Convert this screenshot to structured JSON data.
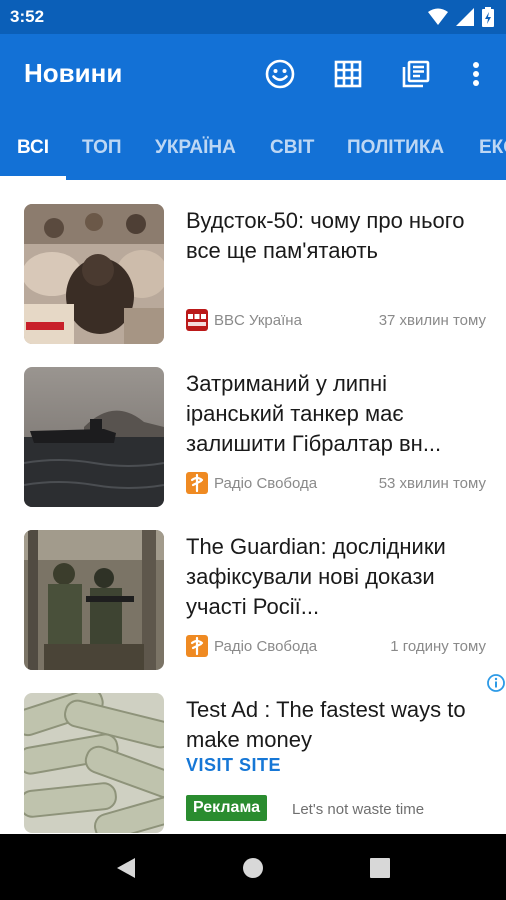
{
  "status": {
    "time": "3:52"
  },
  "app": {
    "title": "Новини"
  },
  "actions": [
    {
      "icon": "emoji-icon"
    },
    {
      "icon": "grid-icon"
    },
    {
      "icon": "library-icon"
    },
    {
      "icon": "more-vert-icon"
    }
  ],
  "tabs": [
    {
      "label": "ВСІ",
      "active": true
    },
    {
      "label": "ТОП"
    },
    {
      "label": "УКРАЇНА"
    },
    {
      "label": "СВІТ"
    },
    {
      "label": "ПОЛІТИКА"
    },
    {
      "label": "ЕКО"
    }
  ],
  "articles": [
    {
      "headline": "Вудсток-50: чому про нього все ще пам'ятають",
      "source": "BBC Україна",
      "time": "37 хвилин тому"
    },
    {
      "headline": "Затриманий у липні іранський танкер має залишити Гібралтар вн...",
      "source": "Радіо Свобода",
      "time": "53 хвилин тому"
    },
    {
      "headline": "The Guardian: дослідники зафіксували нові докази участі Росії...",
      "source": "Радіо Свобода",
      "time": "1 годину тому"
    }
  ],
  "ad": {
    "headline": "Test Ad : The fastest ways to make money",
    "link": "VISIT SITE",
    "badge": "Реклама",
    "description": "Let's not waste time"
  },
  "colors": {
    "app_bar": "#1371d6",
    "status_bar": "#0b5fb8",
    "ad_badge": "#2a8c2f",
    "link": "#1677d6"
  }
}
